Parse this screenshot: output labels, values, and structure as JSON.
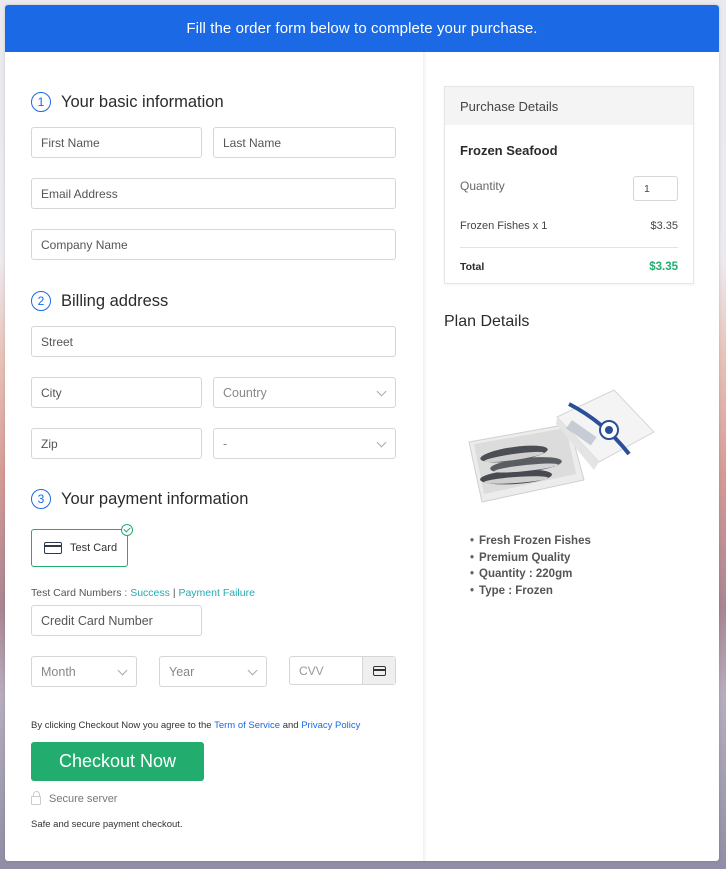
{
  "banner": {
    "text": "Fill the order form below to complete your purchase."
  },
  "sections": {
    "basic": {
      "num": "1",
      "title": "Your basic information"
    },
    "billing": {
      "num": "2",
      "title": "Billing address"
    },
    "payment": {
      "num": "3",
      "title": "Your payment information"
    }
  },
  "fields": {
    "first_name": {
      "placeholder": "First Name",
      "value": ""
    },
    "last_name": {
      "placeholder": "Last Name",
      "value": ""
    },
    "email": {
      "placeholder": "Email Address",
      "value": ""
    },
    "company": {
      "placeholder": "Company Name",
      "value": ""
    },
    "street": {
      "placeholder": "Street",
      "value": ""
    },
    "city": {
      "placeholder": "City",
      "value": ""
    },
    "country": {
      "selected": "Country"
    },
    "zip": {
      "placeholder": "Zip",
      "value": ""
    },
    "state": {
      "selected": "-"
    },
    "card_number": {
      "placeholder": "Credit Card Number",
      "value": ""
    },
    "month": {
      "selected": "Month"
    },
    "year": {
      "selected": "Year"
    },
    "cvv": {
      "placeholder": "CVV",
      "value": ""
    }
  },
  "payment": {
    "method_label": "Test Card",
    "method_selected": true,
    "test_numbers_label": "Test Card Numbers :",
    "success_link": "Success",
    "separator": "|",
    "failure_link": "Payment Failure"
  },
  "agreement": {
    "prefix": "By clicking Checkout Now you agree to the",
    "terms_link": "Term of Service",
    "and": "and",
    "privacy_link": "Privacy Policy"
  },
  "checkout_button": "Checkout Now",
  "secure_label": "Secure server",
  "safe_note": "Safe and secure payment checkout.",
  "purchase": {
    "header": "Purchase Details",
    "product": "Frozen Seafood",
    "quantity_label": "Quantity",
    "quantity": "1",
    "line_item": "Frozen Fishes x 1",
    "line_price": "$3.35",
    "total_label": "Total",
    "total_value": "$3.35"
  },
  "plan": {
    "title": "Plan Details",
    "image_alt": "Box of frozen fish",
    "features": [
      "Fresh Frozen Fishes",
      "Premium Quality",
      "Quantity : 220gm",
      "Type : Frozen"
    ]
  },
  "colors": {
    "brand_blue": "#1b69e4",
    "success_green": "#22ad6e",
    "link_teal": "#25aab3"
  }
}
